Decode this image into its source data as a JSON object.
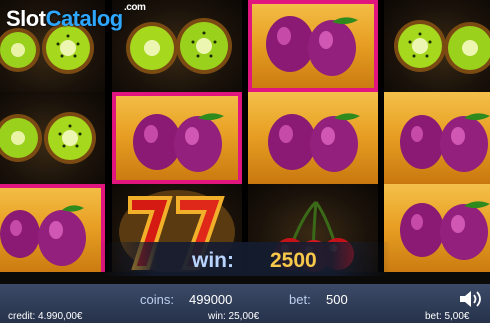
{
  "branding": {
    "logo_slot": "Slot",
    "logo_catalog": "Catalog",
    "logo_com": ".com"
  },
  "win": {
    "label": "win:",
    "value": "2500"
  },
  "bottom": {
    "coins_label": "coins:",
    "coins_value": "499000",
    "bet_label": "bet:",
    "bet_value": "500",
    "credit": "credit: 4.990,00€",
    "win_money": "win: 25,00€",
    "bet_money": "bet: 5,00€"
  },
  "reels": [
    [
      "kiwi",
      "kiwi",
      "plum"
    ],
    [
      "kiwi",
      "plum",
      "seven"
    ],
    [
      "plum",
      "plum",
      "cherry"
    ],
    [
      "kiwi",
      "plum",
      "plum"
    ]
  ],
  "highlighted": [
    [
      1,
      1
    ],
    [
      2,
      0
    ],
    [
      0,
      2
    ]
  ],
  "icons": {
    "sound": "speaker-icon"
  },
  "colors": {
    "highlight": "#e0157d",
    "win_value": "#f7c94a",
    "win_label": "#b9d3ff",
    "bar": "#26324a"
  }
}
